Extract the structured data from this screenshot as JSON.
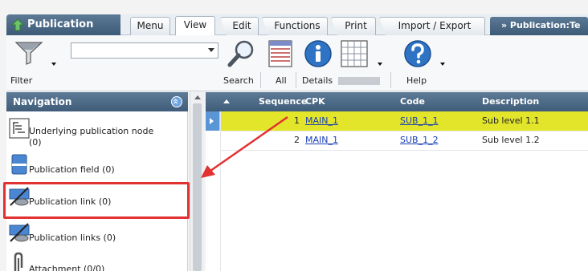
{
  "app": {
    "title": "Publication"
  },
  "tabs": [
    {
      "label": "Menu"
    },
    {
      "label": "View"
    },
    {
      "label": "Edit"
    },
    {
      "label": "Functions"
    },
    {
      "label": "Print"
    },
    {
      "label": "Import / Export"
    }
  ],
  "breadcrumb": "» Publication:Te",
  "toolbar": {
    "filter_label": "Filter",
    "filter_value": "",
    "search_label": "Search",
    "all_label": "All",
    "details_label": "Details",
    "help_label": "Help"
  },
  "navigation": {
    "title": "Navigation",
    "items": [
      {
        "label_line1": "Underlying publication node",
        "label_line2": "(0)"
      },
      {
        "label_line1": "Publication field (0)"
      },
      {
        "label_line1": "Publication link (0)"
      },
      {
        "label_line1": "Publication links (0)"
      },
      {
        "label_line1": "Attachment (0/0)"
      }
    ]
  },
  "grid": {
    "columns": [
      "Sequence",
      "CPK",
      "Code",
      "Description"
    ],
    "rows": [
      {
        "sequence": "1",
        "cpk": "MAIN_1",
        "code": "SUB_1_1",
        "description": "Sub level 1.1"
      },
      {
        "sequence": "2",
        "cpk": "MAIN_1",
        "code": "SUB_1_2",
        "description": "Sub level 1.2"
      }
    ]
  },
  "colors": {
    "header_blue": "#3f5c79",
    "selected_row": "#e2e52a",
    "annotation_red": "#e23131",
    "link": "#1a3fb5"
  }
}
